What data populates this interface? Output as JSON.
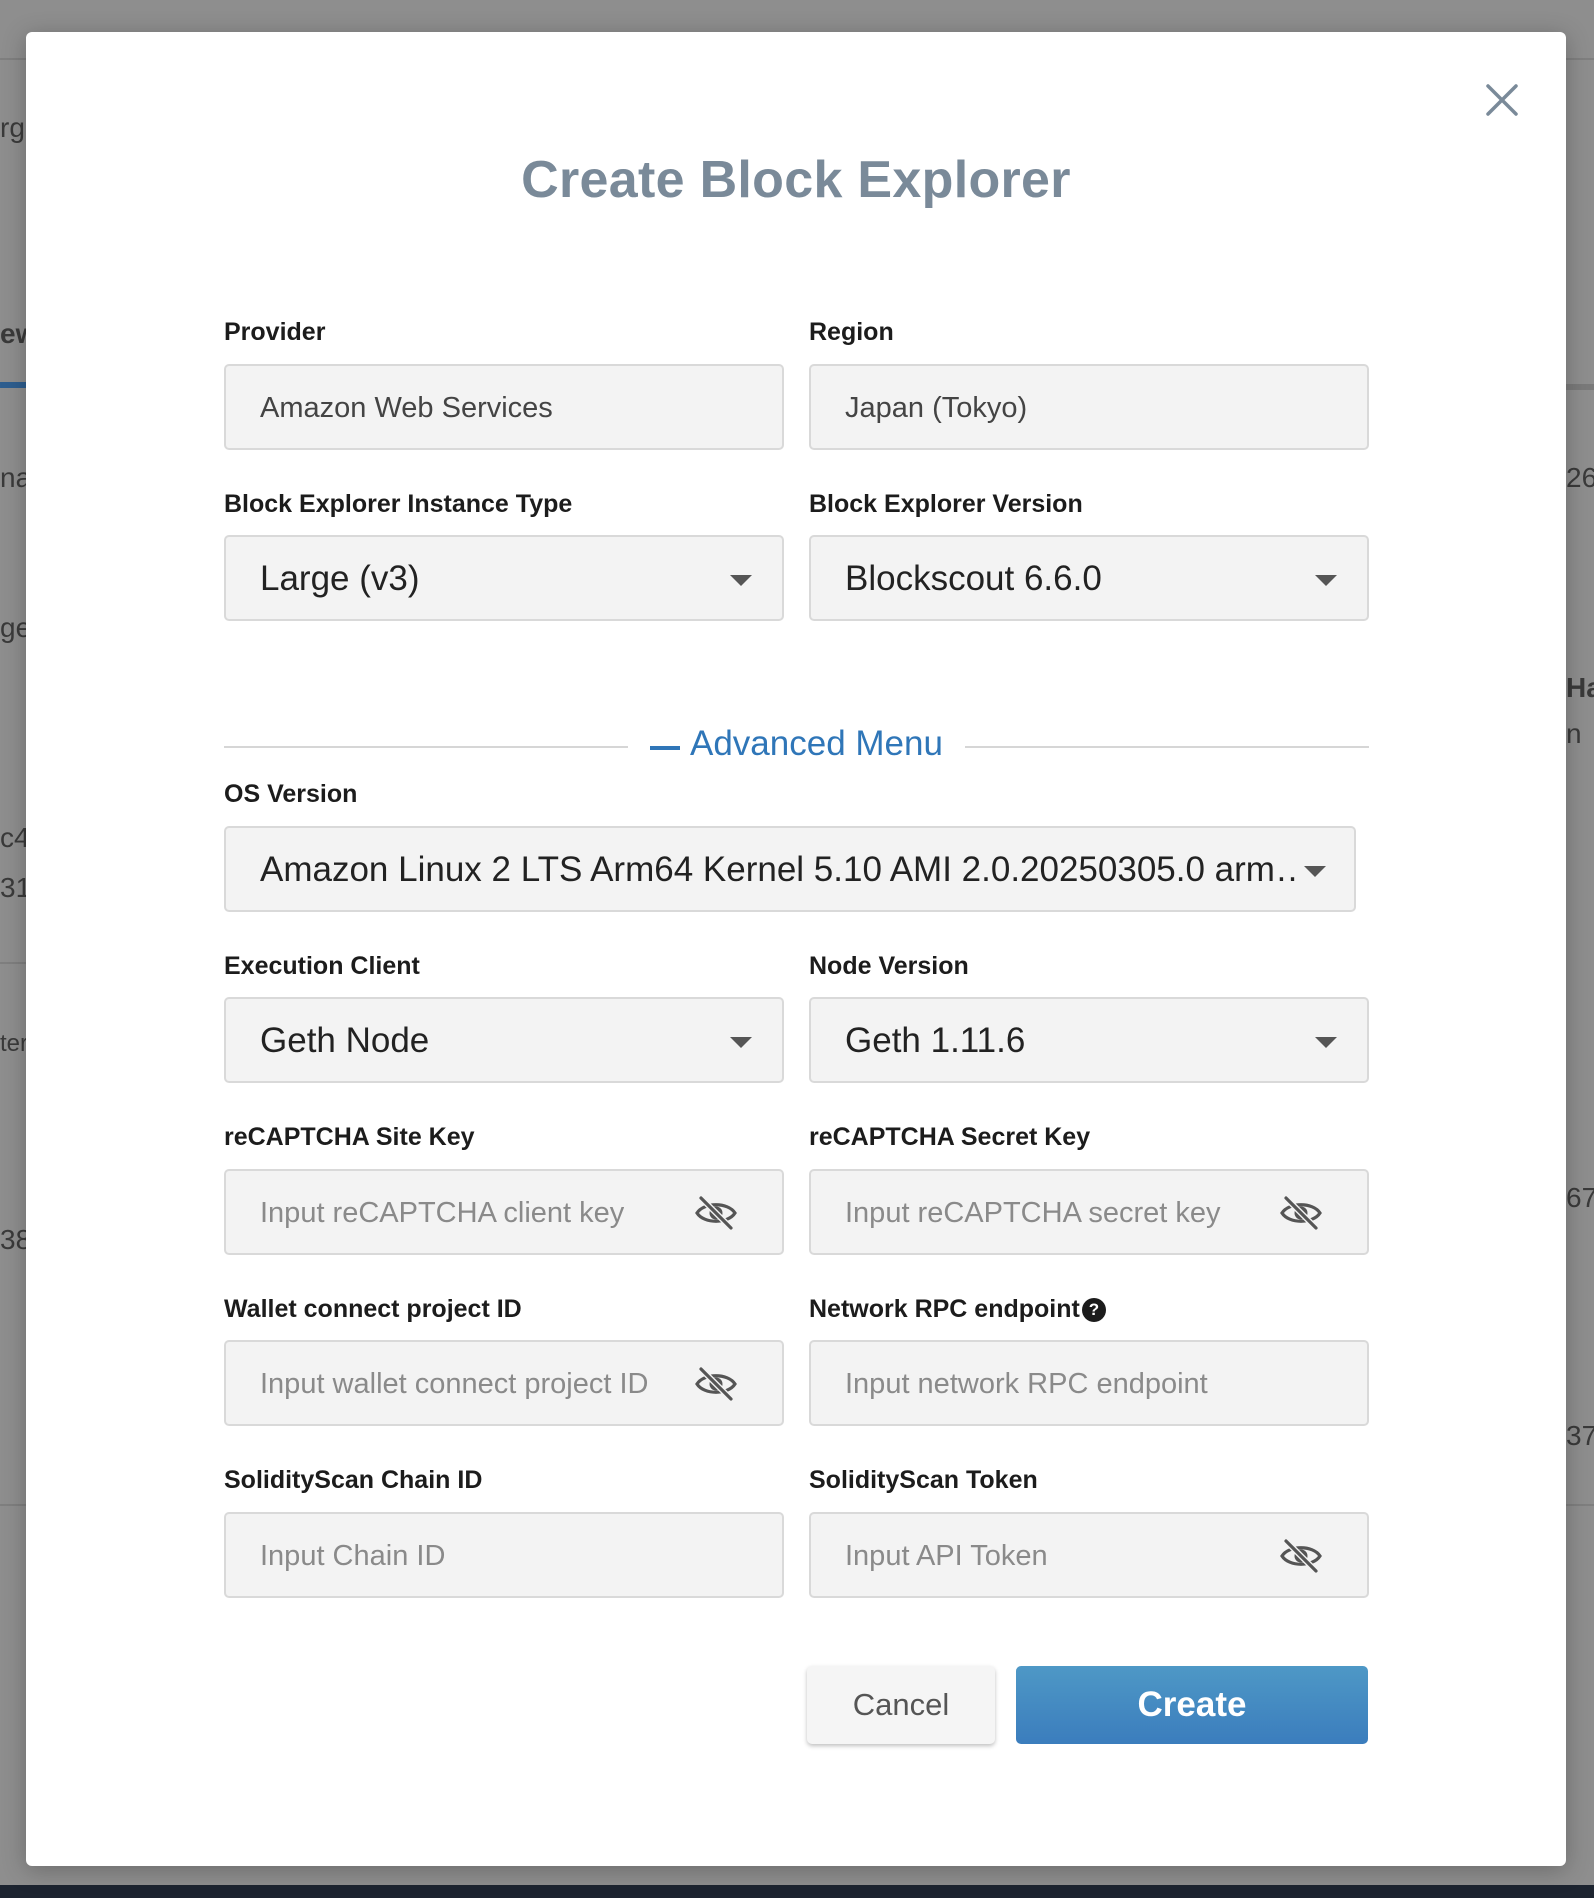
{
  "background": {
    "fragments": [
      "rg",
      "ew",
      "na",
      "ge",
      "26",
      "Har",
      "n",
      "c4",
      "31",
      "ter",
      "67",
      "38",
      "37"
    ]
  },
  "modal": {
    "title": "Create Block Explorer",
    "close_icon": "close-icon"
  },
  "form": {
    "provider": {
      "label": "Provider",
      "value": "Amazon Web Services"
    },
    "region": {
      "label": "Region",
      "value": "Japan (Tokyo)"
    },
    "instance_type": {
      "label": "Block Explorer Instance Type",
      "value": "Large (v3)"
    },
    "version": {
      "label": "Block Explorer Version",
      "value": "Blockscout 6.6.0"
    },
    "advanced_menu": {
      "label": "Advanced Menu",
      "icon": "minus-icon"
    },
    "os_version": {
      "label": "OS Version",
      "value": "Amazon Linux 2 LTS Arm64 Kernel 5.10 AMI 2.0.20250305.0 arm…"
    },
    "execution_client": {
      "label": "Execution Client",
      "value": "Geth Node"
    },
    "node_version": {
      "label": "Node Version",
      "value": "Geth 1.11.6"
    },
    "recaptcha_site_key": {
      "label": "reCAPTCHA Site Key",
      "placeholder": "Input reCAPTCHA client key",
      "icon": "eye-off-icon"
    },
    "recaptcha_secret_key": {
      "label": "reCAPTCHA Secret Key",
      "placeholder": "Input reCAPTCHA secret key",
      "icon": "eye-off-icon"
    },
    "wallet_connect": {
      "label": "Wallet connect project ID",
      "placeholder": "Input wallet connect project ID",
      "icon": "eye-off-icon"
    },
    "network_rpc": {
      "label": "Network RPC endpoint",
      "placeholder": "Input network RPC endpoint",
      "help_icon": "question-circle-icon",
      "help_glyph": "?"
    },
    "solidityscan_chain_id": {
      "label": "SolidityScan Chain ID",
      "placeholder": "Input Chain ID"
    },
    "solidityscan_token": {
      "label": "SolidityScan Token",
      "placeholder": "Input API Token",
      "icon": "eye-off-icon"
    }
  },
  "actions": {
    "cancel_label": "Cancel",
    "create_label": "Create"
  },
  "colors": {
    "title": "#7a8a99",
    "accent": "#2f76b8",
    "create_button": "#3b7dbd",
    "field_bg": "#f3f3f3",
    "overlay": "#8c8c8c"
  }
}
